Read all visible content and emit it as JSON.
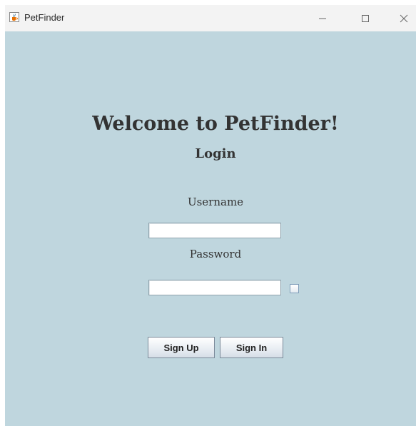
{
  "window": {
    "title": "PetFinder",
    "icon": "java-cup-icon",
    "controls": [
      "minimize-icon",
      "maximize-icon",
      "close-icon"
    ]
  },
  "main": {
    "heading": "Welcome to PetFinder!",
    "subheading": "Login",
    "username_label": "Username",
    "username_value": "",
    "password_label": "Password",
    "password_value": "",
    "show_password_checked": false,
    "signup_label": "Sign Up",
    "signin_label": "Sign In"
  },
  "colors": {
    "background": "#bfd6de",
    "titlebar": "#f3f3f3",
    "text": "#333333"
  }
}
